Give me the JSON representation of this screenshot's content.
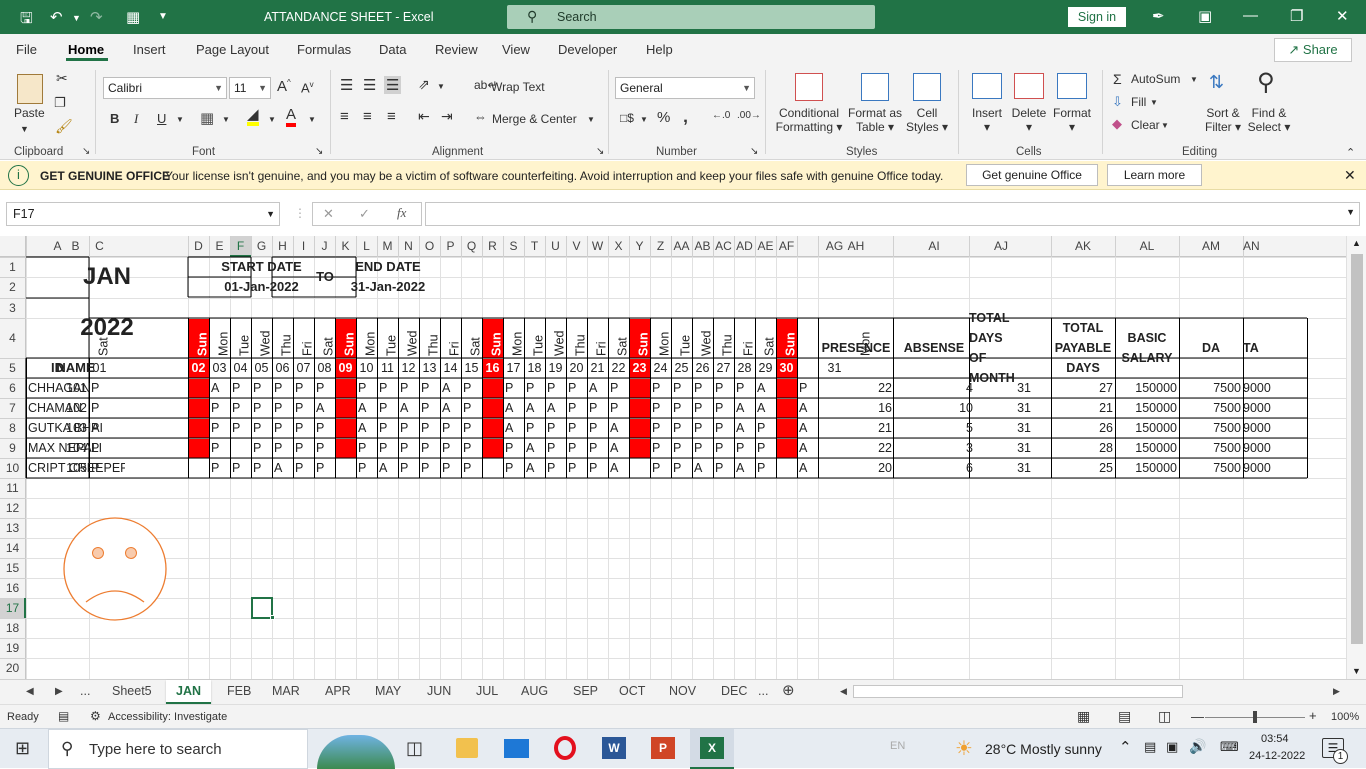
{
  "window": {
    "title": "ATTANDANCE SHEET  -  Excel",
    "search_placeholder": "Search",
    "signin_label": "Sign in"
  },
  "menu": [
    {
      "label": "File"
    },
    {
      "label": "Home",
      "active": true
    },
    {
      "label": "Insert"
    },
    {
      "label": "Page Layout"
    },
    {
      "label": "Formulas"
    },
    {
      "label": "Data"
    },
    {
      "label": "Review"
    },
    {
      "label": "View"
    },
    {
      "label": "Developer"
    },
    {
      "label": "Help"
    }
  ],
  "share_label": "Share",
  "ribbon": {
    "groups": [
      "Clipboard",
      "Font",
      "Alignment",
      "Number",
      "Styles",
      "Cells",
      "Editing"
    ],
    "paste_label": "Paste",
    "font_name": "Calibri",
    "font_size": "11",
    "wrap_text": "Wrap Text",
    "merge_center": "Merge & Center",
    "number_format": "General",
    "conditional_formatting": [
      "Conditional",
      "Formatting"
    ],
    "format_as_table": [
      "Format as",
      "Table"
    ],
    "cell_styles": [
      "Cell",
      "Styles"
    ],
    "insert": "Insert",
    "delete": "Delete",
    "format": "Format",
    "autosum": "AutoSum",
    "fill": "Fill",
    "clear": "Clear",
    "sort_filter": [
      "Sort &",
      "Filter"
    ],
    "find_select": [
      "Find &",
      "Select"
    ],
    "bold": "B",
    "italic": "I",
    "underline": "U"
  },
  "infobar": {
    "title": "GET GENUINE OFFICE",
    "message": "Your license isn't genuine, and you may be a victim of software counterfeiting. Avoid interruption and keep your files safe with genuine Office today.",
    "btn_get": "Get genuine Office",
    "btn_learn": "Learn more"
  },
  "formula": {
    "namebox": "F17",
    "value": ""
  },
  "colors": {
    "excel_green": "#217346",
    "sunday_red": "#ff0000",
    "face": "#ed7d31",
    "selection": "#217346"
  },
  "sheet": {
    "month": "JAN",
    "year": "2022",
    "start_label": "START DATE",
    "start_value": "01-Jan-2022",
    "to_label": "TO",
    "end_label": "END DATE",
    "end_value": "31-Jan-2022",
    "col_letters": [
      "A",
      "B",
      "C",
      "D",
      "E",
      "F",
      "G",
      "H",
      "I",
      "J",
      "K",
      "L",
      "M",
      "N",
      "O",
      "P",
      "Q",
      "R",
      "S",
      "T",
      "U",
      "V",
      "W",
      "X",
      "Y",
      "Z",
      "AA",
      "AB",
      "AC",
      "AD",
      "AE",
      "AF",
      "AG",
      "AH",
      "AI",
      "AJ",
      "AK",
      "AL",
      "AM",
      "AN"
    ],
    "row_numbers": [
      "1",
      "2",
      "3",
      "4",
      "5",
      "6",
      "7",
      "8",
      "9",
      "10",
      "11",
      "12",
      "13",
      "14",
      "15",
      "16",
      "17",
      "18",
      "19",
      "20"
    ],
    "weekdays": [
      "Sat",
      "Sun",
      "Mon",
      "Tue",
      "Wed",
      "Thu",
      "Fri",
      "Sat",
      "Sun",
      "Mon",
      "Tue",
      "Wed",
      "Thu",
      "Fri",
      "Sat",
      "Sun",
      "Mon",
      "Tue",
      "Wed",
      "Thu",
      "Fri",
      "Sat",
      "Sun",
      "Mon",
      "Tue",
      "Wed",
      "Thu",
      "Fri",
      "Sat",
      "Sun",
      "Mon"
    ],
    "dates": [
      "01",
      "02",
      "03",
      "04",
      "05",
      "06",
      "07",
      "08",
      "09",
      "10",
      "11",
      "12",
      "13",
      "14",
      "15",
      "16",
      "17",
      "18",
      "19",
      "20",
      "21",
      "22",
      "23",
      "24",
      "25",
      "26",
      "27",
      "28",
      "29",
      "30",
      "31"
    ],
    "sunday_idx": [
      1,
      8,
      15,
      22,
      29
    ],
    "hdr_id": "ID",
    "hdr_name": "NAME",
    "summary_headers": [
      [
        "PRESENCE"
      ],
      [
        "ABSENSE"
      ],
      [
        "TOTAL DAYS",
        "OF MONTH"
      ],
      [
        "TOTAL",
        "PAYABLE",
        "DAYS"
      ],
      [
        "BASIC",
        "SALARY"
      ],
      [
        "DA"
      ],
      [
        "TA"
      ]
    ],
    "employees": [
      {
        "id": "101",
        "name": "CHHAGAN",
        "att": [
          "P",
          "",
          "A",
          "P",
          "P",
          "P",
          "P",
          "P",
          "",
          "P",
          "P",
          "P",
          "P",
          "A",
          "P",
          "",
          "P",
          "P",
          "P",
          "P",
          "A",
          "P",
          "",
          "P",
          "P",
          "P",
          "P",
          "P",
          "A",
          "",
          "P"
        ],
        "summary": [
          "22",
          "4",
          "31",
          "27",
          "150000",
          "7500",
          "9000"
        ]
      },
      {
        "id": "102",
        "name": "CHAMAN",
        "att": [
          "P",
          "",
          "P",
          "P",
          "P",
          "P",
          "P",
          "A",
          "",
          "A",
          "P",
          "A",
          "P",
          "A",
          "P",
          "",
          "A",
          "A",
          "A",
          "P",
          "P",
          "P",
          "",
          "P",
          "P",
          "P",
          "P",
          "A",
          "A",
          "",
          "A"
        ],
        "summary": [
          "16",
          "10",
          "31",
          "21",
          "150000",
          "7500",
          "9000"
        ]
      },
      {
        "id": "103",
        "name": "GUTKA BHAI",
        "att": [
          "P",
          "",
          "P",
          "P",
          "P",
          "P",
          "P",
          "P",
          "",
          "A",
          "P",
          "P",
          "P",
          "P",
          "P",
          "",
          "A",
          "P",
          "P",
          "P",
          "P",
          "A",
          "",
          "P",
          "P",
          "P",
          "P",
          "A",
          "P",
          "",
          "A"
        ],
        "summary": [
          "21",
          "5",
          "31",
          "26",
          "150000",
          "7500",
          "9000"
        ]
      },
      {
        "id": "104",
        "name": "MAX NEPALI",
        "att": [
          "P",
          "",
          "P",
          "",
          "P",
          "P",
          "P",
          "P",
          "",
          "P",
          "P",
          "P",
          "P",
          "P",
          "P",
          "",
          "P",
          "A",
          "P",
          "P",
          "P",
          "A",
          "",
          "P",
          "P",
          "P",
          "P",
          "P",
          "P",
          "",
          "A"
        ],
        "summary": [
          "22",
          "3",
          "31",
          "28",
          "150000",
          "7500",
          "9000"
        ]
      },
      {
        "id": "105",
        "name": "CRIPT CREEPER",
        "att": [
          "P",
          "",
          "P",
          "P",
          "P",
          "A",
          "P",
          "P",
          "",
          "P",
          "A",
          "P",
          "P",
          "P",
          "P",
          "",
          "P",
          "A",
          "P",
          "P",
          "P",
          "A",
          "",
          "P",
          "P",
          "A",
          "P",
          "A",
          "P",
          "",
          "A"
        ],
        "summary": [
          "20",
          "6",
          "31",
          "25",
          "150000",
          "7500",
          "9000"
        ]
      }
    ]
  },
  "tabs": [
    {
      "label": "Sheet5"
    },
    {
      "label": "JAN",
      "active": true
    },
    {
      "label": "FEB"
    },
    {
      "label": "MAR"
    },
    {
      "label": "APR"
    },
    {
      "label": "MAY"
    },
    {
      "label": "JUN"
    },
    {
      "label": "JUL"
    },
    {
      "label": "AUG"
    },
    {
      "label": "SEP"
    },
    {
      "label": "OCT"
    },
    {
      "label": "NOV"
    },
    {
      "label": "DEC"
    }
  ],
  "tab_overflow": "...",
  "status": {
    "ready": "Ready",
    "accessibility": "Accessibility: Investigate",
    "zoom": "100%"
  },
  "taskbar": {
    "search_placeholder": "Type here to search",
    "lang": "EN",
    "weather": "28°C  Mostly sunny",
    "time": "03:54",
    "date": "24-12-2022",
    "notif_count": "1"
  }
}
